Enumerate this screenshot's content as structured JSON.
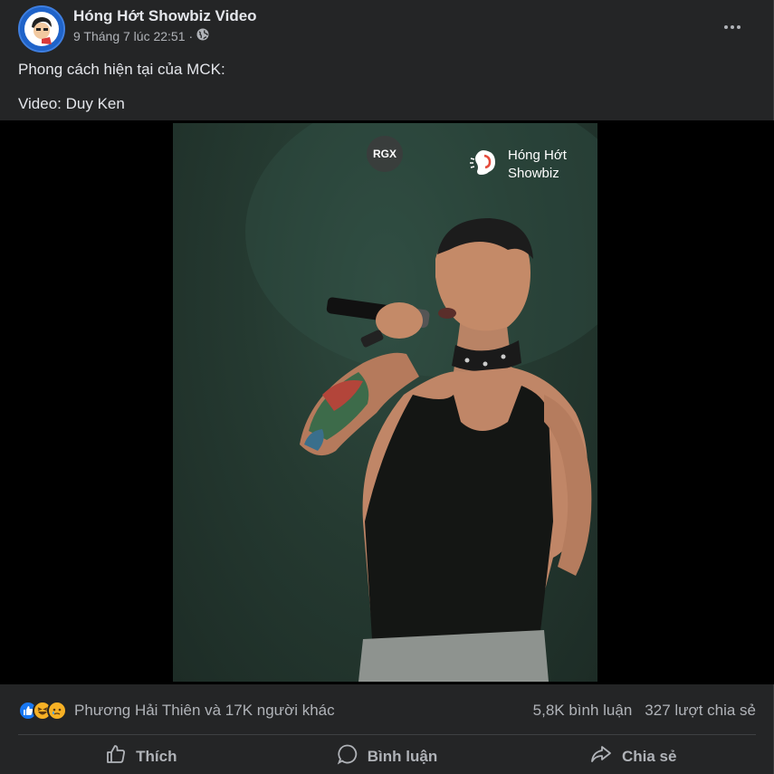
{
  "post": {
    "page_name": "Hóng Hớt Showbiz Video",
    "timestamp": "9 Tháng 7 lúc 22:51",
    "audience_icon": "globe-icon",
    "caption_lines": [
      "Phong cách hiện tại của MCK:",
      "Video: Duy Ken"
    ]
  },
  "video": {
    "badge": "RGX",
    "watermark_line1": "Hóng Hớt",
    "watermark_line2": "Showbiz"
  },
  "reactions": {
    "icons": [
      "like-icon",
      "haha-icon",
      "sad-icon"
    ],
    "summary": "Phương Hải Thiên và 17K người khác",
    "comments": "5,8K bình luận",
    "shares": "327 lượt chia sẻ"
  },
  "actions": {
    "like": "Thích",
    "comment": "Bình luận",
    "share": "Chia sẻ"
  },
  "colors": {
    "background": "#242526",
    "text": "#e4e6eb",
    "secondary": "#b0b3b8",
    "like_blue": "#1877f2",
    "emoji_yellow": "#f7b125"
  }
}
